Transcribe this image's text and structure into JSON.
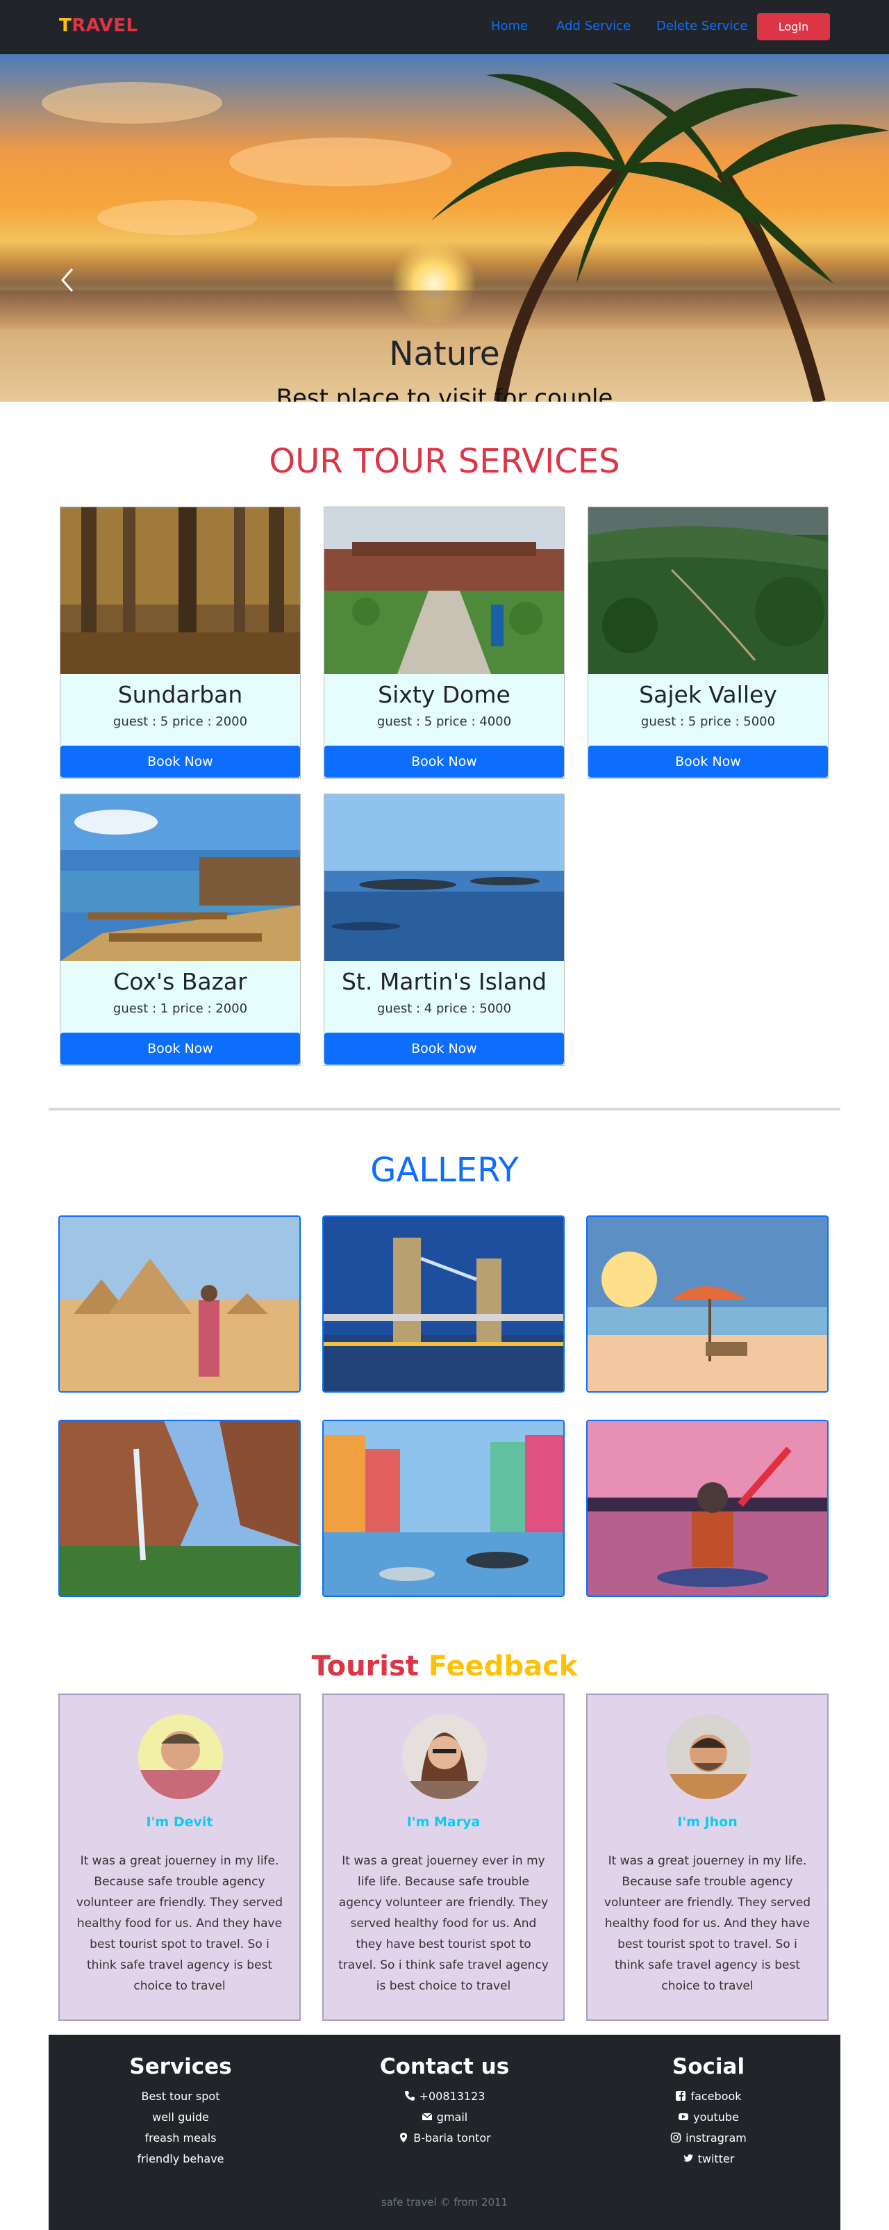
{
  "navbar": {
    "brand_first": "T",
    "brand_rest": "RAVEL",
    "links": [
      "Home",
      "Add Service",
      "Delete Service"
    ],
    "login_label": "LogIn"
  },
  "hero": {
    "title": "Nature",
    "subtitle": "Best place to visit for couple",
    "slide_count": 3,
    "active_slide": 1
  },
  "services": {
    "title": "OUR TOUR SERVICES",
    "book_label": "Book Now",
    "items": [
      {
        "name": "Sundarban",
        "meta": "guest : 5  price : 2000"
      },
      {
        "name": "Sixty Dome",
        "meta": "guest : 5  price : 4000"
      },
      {
        "name": "Sajek Valley",
        "meta": "guest : 5  price : 5000"
      },
      {
        "name": "Cox's Bazar",
        "meta": "guest : 1  price : 2000"
      },
      {
        "name": "St. Martin's Island",
        "meta": "guest : 4  price : 5000"
      }
    ]
  },
  "gallery": {
    "title": "GALLERY"
  },
  "feedback": {
    "title_part1": "Tourist",
    "title_part2": "Feedback",
    "items": [
      {
        "name": "I'm Devit",
        "text": "It was a great jouerney in my life. Because safe trouble agency volunteer are friendly. They served healthy food for us. And they have best tourist spot to travel. So i think safe travel agency is best choice to travel"
      },
      {
        "name": "I'm Marya",
        "text": "It was a great jouerney ever in my life life. Because safe trouble agency volunteer are friendly. They served healthy food for us. And they have best tourist spot to travel. So i think safe travel agency is best choice to travel"
      },
      {
        "name": "I'm Jhon",
        "text": "It was a great jouerney in my life. Because safe trouble agency volunteer are friendly. They served healthy food for us. And they have best tourist spot to travel. So i think safe travel agency is best choice to travel"
      }
    ]
  },
  "footer": {
    "services_title": "Services",
    "services_lines": [
      "Best tour spot",
      "well guide",
      "freash meals",
      "friendly behave"
    ],
    "contact_title": "Contact us",
    "contact_lines": [
      "+00813123",
      "gmail",
      "B-baria tontor"
    ],
    "social_title": "Social",
    "social_lines": [
      "facebook",
      "youtube",
      "instragram",
      "twitter"
    ],
    "copyright": "safe travel © from 2011"
  },
  "colors": {
    "nav_bg": "#212529",
    "brand_yellow": "#ffc107",
    "brand_red": "#dc3545",
    "primary": "#0d6efd",
    "info": "#0dcaf0",
    "card_bg": "#e5fdfd",
    "feedback_bg": "#e1d3ea"
  }
}
